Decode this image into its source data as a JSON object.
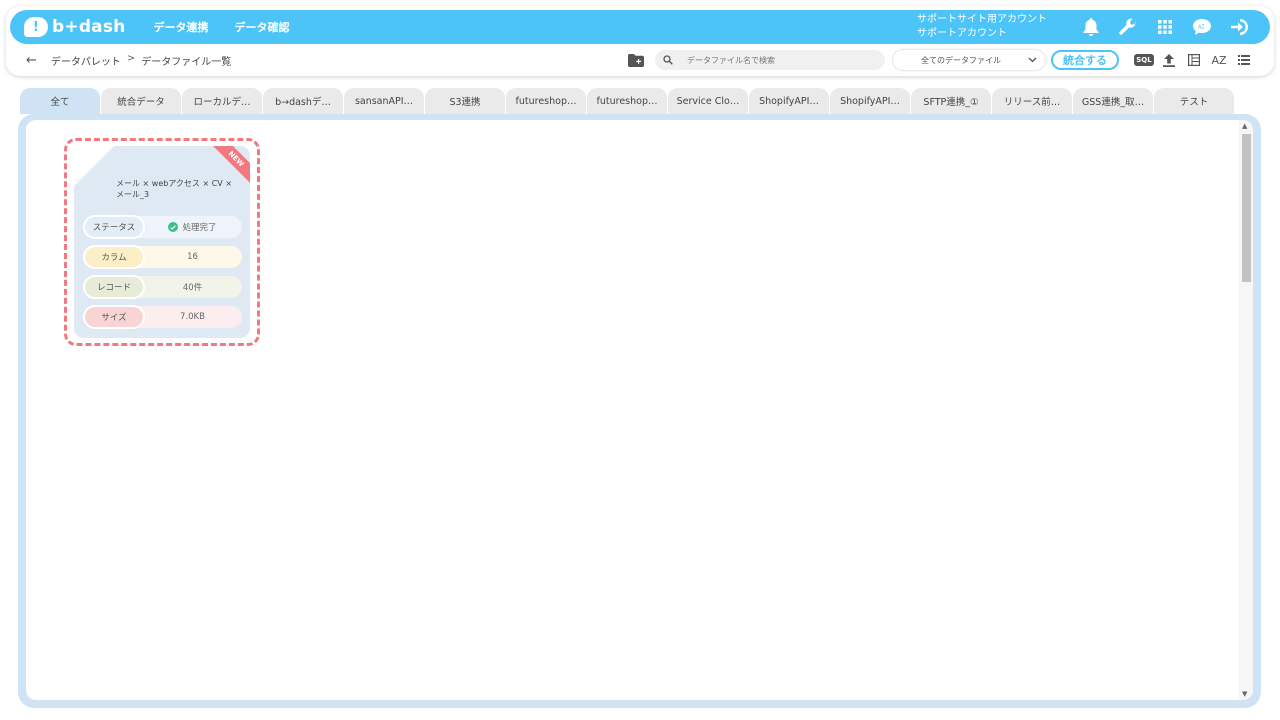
{
  "header": {
    "logo_text": "b+dash",
    "nav": [
      "データ連携",
      "データ確認"
    ],
    "account_line1": "サポートサイト用アカウント",
    "account_line2": "サポートアカウント"
  },
  "subbar": {
    "breadcrumb": [
      "データパレット",
      "データファイル一覧"
    ],
    "breadcrumb_sep": ">",
    "search_placeholder": "データファイル名で検索",
    "filter_selected": "全てのデータファイル",
    "merge_label": "統合する",
    "sql_label": "SQL",
    "az_label": "AZ"
  },
  "tabs": [
    "全て",
    "統合データ",
    "ローカルデ…",
    "b→dashデ…",
    "sansanAPI…",
    "S3連携",
    "futureshop…",
    "futureshop…",
    "Service Clo…",
    "ShopifyAPI…",
    "ShopifyAPI…",
    "SFTP連携_①",
    "リリース前…",
    "GSS連携_取…",
    "テスト"
  ],
  "active_tab": 0,
  "file_card": {
    "badge": "NEW",
    "title": "メール × webアクセス × CV × メール_3",
    "stats": [
      {
        "label": "ステータス",
        "value": "処理完了"
      },
      {
        "label": "カラム",
        "value": "16"
      },
      {
        "label": "レコード",
        "value": "40件"
      },
      {
        "label": "サイズ",
        "value": "7.0KB"
      }
    ]
  },
  "colors": {
    "brand": "#4dc4f8",
    "panel": "#cfe3f5",
    "new_badge": "#f07a80",
    "status_ok": "#3cbf8a"
  }
}
